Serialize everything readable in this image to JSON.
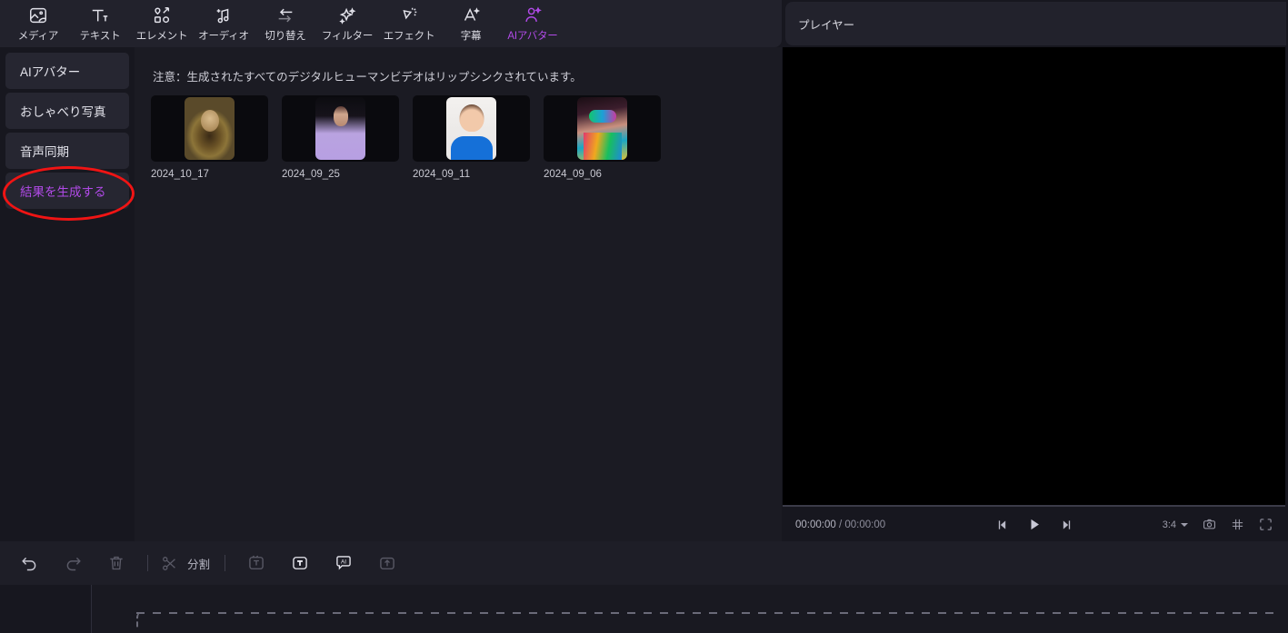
{
  "toolbar": {
    "items": [
      {
        "label": "メディア",
        "icon": "media-icon"
      },
      {
        "label": "テキスト",
        "icon": "text-icon"
      },
      {
        "label": "エレメント",
        "icon": "element-icon"
      },
      {
        "label": "オーディオ",
        "icon": "audio-icon"
      },
      {
        "label": "切り替え",
        "icon": "transition-icon"
      },
      {
        "label": "フィルター",
        "icon": "filter-icon"
      },
      {
        "label": "エフェクト",
        "icon": "effect-icon"
      },
      {
        "label": "字幕",
        "icon": "subtitle-icon"
      },
      {
        "label": "AIアバター",
        "icon": "ai-avatar-icon"
      }
    ],
    "active_index": 8,
    "accent_color": "#b14ae8"
  },
  "sidebar": {
    "items": [
      {
        "label": "AIアバター"
      },
      {
        "label": "おしゃべり写真"
      },
      {
        "label": "音声同期"
      },
      {
        "label": "結果を生成する"
      }
    ],
    "selected_index": 3,
    "annotation": {
      "shape": "ellipse",
      "color": "#f01414",
      "around": "結果を生成する"
    }
  },
  "content": {
    "notice": "注意：生成されたすべてのデジタルヒューマンビデオはリップシンクされています。",
    "cards": [
      {
        "caption": "2024_10_17",
        "art": "art-mona"
      },
      {
        "caption": "2024_09_25",
        "art": "art-woman"
      },
      {
        "caption": "2024_09_11",
        "art": "art-boy"
      },
      {
        "caption": "2024_09_06",
        "art": "art-girl"
      }
    ]
  },
  "player": {
    "title": "プレイヤー",
    "current_time": "00:00:00",
    "separator": "/",
    "total_time": "00:00:00",
    "aspect_ratio": "3:4",
    "transport": [
      "prev-frame-button",
      "play-button",
      "next-frame-button"
    ],
    "right_icons": [
      "snapshot-icon",
      "grid-icon",
      "fullscreen-icon"
    ]
  },
  "bottom_toolbar": {
    "undo": "undo-icon",
    "redo": "redo-icon",
    "delete": "delete-icon",
    "split_label": "分割",
    "split_icon": "scissors-icon",
    "items": [
      "text-template-icon",
      "text-box-icon",
      "ai-caption-icon",
      "export-icon"
    ]
  },
  "timeline": {
    "dropzone_hint": ""
  }
}
